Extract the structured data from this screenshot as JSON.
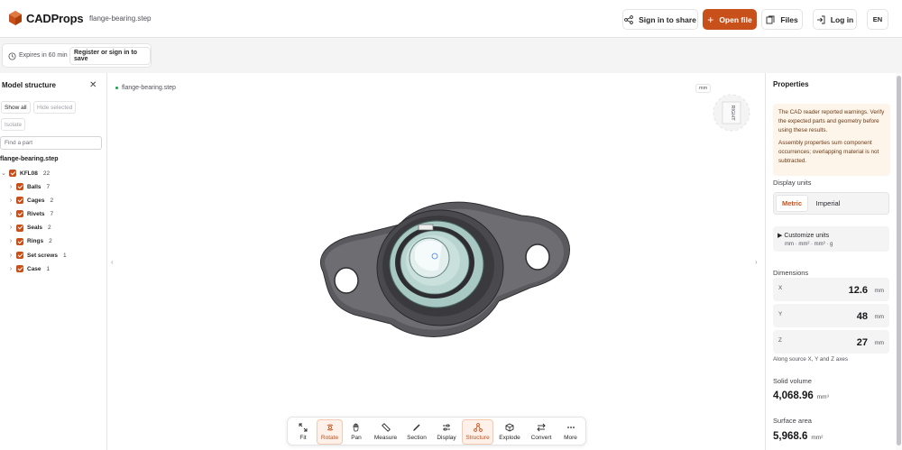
{
  "app": {
    "name": "CADProps",
    "file_name": "flange-bearing.step",
    "brand_color": "#c8501a"
  },
  "header": {
    "sign_in_share": "Sign in to share",
    "open_file": "Open file",
    "files": "Files",
    "log_in": "Log in",
    "language": "EN"
  },
  "session": {
    "expires": "Expires in 60 min",
    "register": "Register or sign in to save"
  },
  "structure": {
    "title": "Model structure",
    "show_all": "Show all",
    "hide_selected": "Hide selected",
    "isolate": "Isolate",
    "search_placeholder": "Find a part",
    "root_file": "flange-bearing.step",
    "assembly": {
      "name": "KFL08",
      "count": "22"
    },
    "items": [
      {
        "name": "Balls",
        "count": "7"
      },
      {
        "name": "Cages",
        "count": "2"
      },
      {
        "name": "Rivets",
        "count": "7"
      },
      {
        "name": "Seals",
        "count": "2"
      },
      {
        "name": "Rings",
        "count": "2"
      },
      {
        "name": "Set screws",
        "count": "1"
      },
      {
        "name": "Case",
        "count": "1"
      }
    ]
  },
  "viewport": {
    "file_label": "flange-bearing.step",
    "unit_badge": "mm",
    "viewcube_face": "RIGHT"
  },
  "toolbar": {
    "tools": [
      {
        "label": "Fit",
        "icon": "fit-icon",
        "active": false
      },
      {
        "label": "Rotate",
        "icon": "rotate-icon",
        "active": true
      },
      {
        "label": "Pan",
        "icon": "hand-icon",
        "active": false
      },
      {
        "label": "Measure",
        "icon": "ruler-icon",
        "active": false
      },
      {
        "label": "Section",
        "icon": "pen-icon",
        "active": false
      },
      {
        "label": "Display",
        "icon": "sliders-icon",
        "active": false
      },
      {
        "label": "Structure",
        "icon": "structure-icon",
        "active": true
      },
      {
        "label": "Explode",
        "icon": "explode-icon",
        "active": false
      },
      {
        "label": "Convert",
        "icon": "convert-icon",
        "active": false
      },
      {
        "label": "More",
        "icon": "more-icon",
        "active": false
      }
    ]
  },
  "properties": {
    "title": "Properties",
    "warning_1": "The CAD reader reported warnings. Verify the expected parts and geometry before using these results.",
    "warning_2": "Assembly properties sum component occurrences; overlapping material is not subtracted.",
    "display_units_label": "Display units",
    "metric": "Metric",
    "imperial": "Imperial",
    "customize": "▶ Customize units",
    "customize_sub": "mm · mm² · mm³ · g",
    "dimensions_label": "Dimensions",
    "dims": [
      {
        "axis": "X",
        "value": "12.6",
        "unit": "mm"
      },
      {
        "axis": "Y",
        "value": "48",
        "unit": "mm"
      },
      {
        "axis": "Z",
        "value": "27",
        "unit": "mm"
      }
    ],
    "axes_note": "Along source X, Y and Z axes",
    "solid_volume_label": "Solid volume",
    "solid_volume": "4,068.96",
    "solid_volume_unit": "mm³",
    "surface_area_label": "Surface area",
    "surface_area": "5,968.6",
    "surface_area_unit": "mm²"
  }
}
